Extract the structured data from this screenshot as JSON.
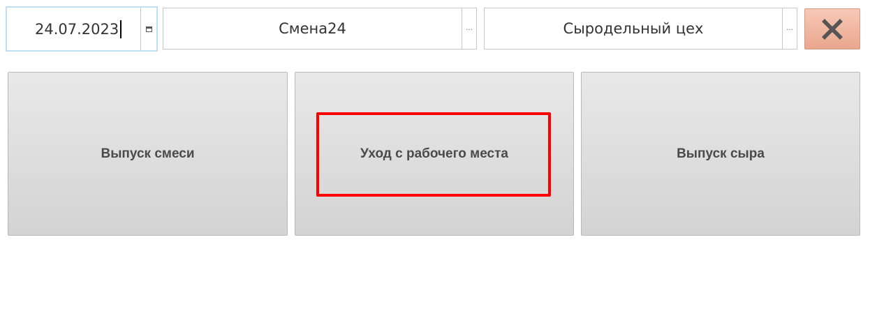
{
  "toolbar": {
    "date": {
      "value": "24.07.2023",
      "button_icon": "calendar-icon"
    },
    "shift": {
      "value": "Смена24",
      "button_label": "..."
    },
    "department": {
      "value": "Сыродельный цех",
      "button_label": "..."
    },
    "close_button": {
      "icon": "close-icon",
      "color": "#f0b39c"
    }
  },
  "tiles": [
    {
      "label": "Выпуск смеси"
    },
    {
      "label": "Уход с рабочего места"
    },
    {
      "label": "Выпуск сыра"
    }
  ],
  "highlight": {
    "target": "Уход с рабочего места",
    "color": "#ff0000"
  }
}
